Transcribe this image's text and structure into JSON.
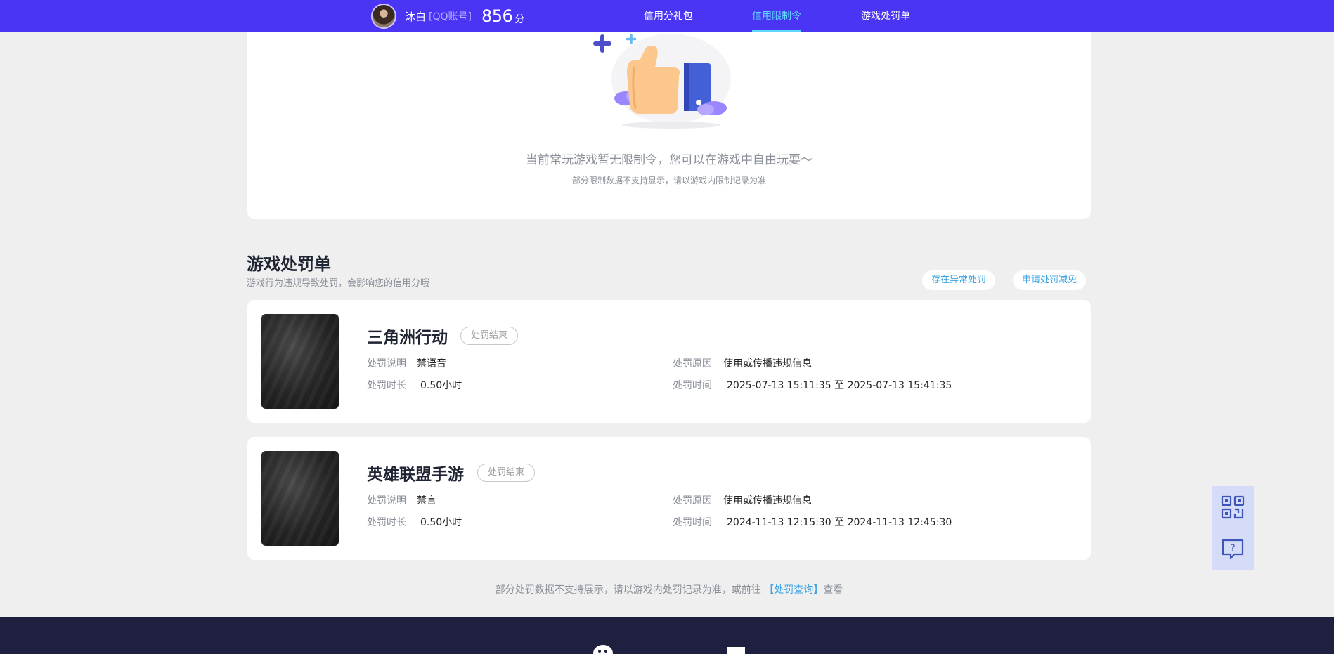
{
  "header": {
    "user_name": "沐白",
    "account_type": "[QQ账号]",
    "score": "856",
    "score_unit": "分",
    "nav": [
      "信用分礼包",
      "信用限制令",
      "游戏处罚单"
    ],
    "active_nav": "信用限制令"
  },
  "restriction": {
    "message": "当前常玩游戏暂无限制令，您可以在游戏中自由玩耍～",
    "note": "部分限制数据不支持显示，请以游戏内限制记录为准"
  },
  "punishments": {
    "title": "游戏处罚单",
    "subtitle": "游戏行为违规导致处罚，会影响您的信用分哦",
    "abnormal_button": "存在异常处罚",
    "appeal_button": "申请处罚减免",
    "labels": {
      "desc": "处罚说明",
      "duration": "处罚时长",
      "reason": "处罚原因",
      "time": "处罚时间"
    },
    "items": [
      {
        "game": "三角洲行动",
        "status": "处罚结束",
        "desc": "禁语音",
        "duration": "0.50小时",
        "reason": "使用或传播违规信息",
        "time": "2025-07-13 15:11:35 至 2025-07-13 15:41:35"
      },
      {
        "game": "英雄联盟手游",
        "status": "处罚结束",
        "desc": "禁言",
        "duration": "0.50小时",
        "reason": "使用或传播违规信息",
        "time": "2024-11-13 12:15:30 至 2024-11-13 12:45:30"
      }
    ],
    "footer_note_prefix": "部分处罚数据不支持展示，请以游戏内处罚记录为准，或前往",
    "footer_link": "【处罚查询】",
    "footer_note_suffix": "查看"
  },
  "icons": {
    "qr": "qr-code-icon",
    "help": "help-question-icon"
  },
  "colors": {
    "topbar": "#4b35f5",
    "active_nav": "#5fd9ff",
    "link": "#3ea4e6"
  }
}
